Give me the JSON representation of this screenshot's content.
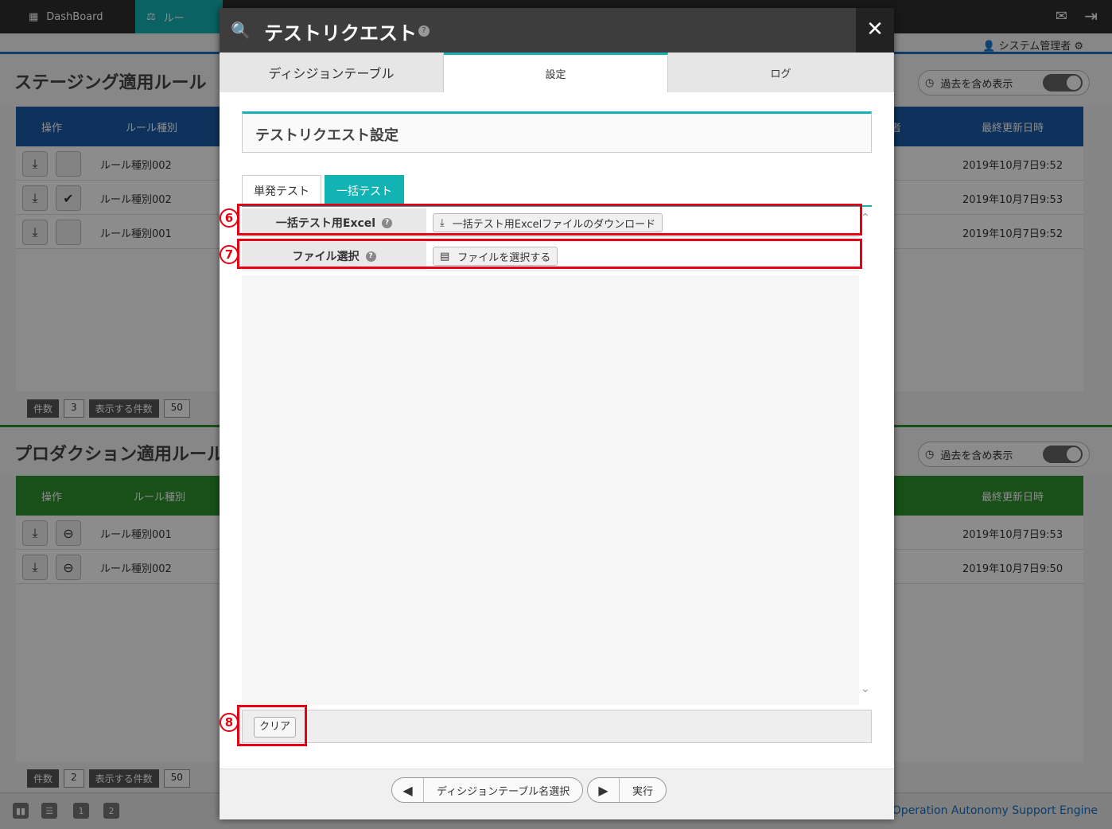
{
  "nav": {
    "dashboard": "DashBoard",
    "rules": "ルー"
  },
  "user": {
    "name": "システム管理者"
  },
  "staging": {
    "title": "ステージング適用ルール",
    "toggle_label": "過去を含め表示",
    "toggle_state": "OFF",
    "headers": {
      "ops": "操作",
      "type": "ルール種別",
      "author": "者",
      "updated": "最終更新日時"
    },
    "rows": [
      {
        "type": "ルール種別002",
        "updated": "2019年10月7日9:52"
      },
      {
        "type": "ルール種別002",
        "updated": "2019年10月7日9:53"
      },
      {
        "type": "ルール種別001",
        "updated": "2019年10月7日9:52"
      }
    ],
    "count_label": "件数",
    "count": "3",
    "per_page_label": "表示する件数",
    "per_page": "50"
  },
  "production": {
    "title": "プロダクション適用ルール",
    "toggle_label": "過去を含め表示",
    "toggle_state": "OFF",
    "headers": {
      "ops": "操作",
      "type": "ルール種別",
      "updated": "最終更新日時"
    },
    "rows": [
      {
        "type": "ルール種別001",
        "updated": "2019年10月7日9:53"
      },
      {
        "type": "ルール種別002",
        "updated": "2019年10月7日9:50"
      }
    ],
    "count_label": "件数",
    "count": "2",
    "per_page_label": "表示する件数",
    "per_page": "50"
  },
  "footer": {
    "text": "o Operation Autonomy Support Engine",
    "page1": "1",
    "page2": "2"
  },
  "modal": {
    "title": "テストリクエスト",
    "tabs": [
      "ディシジョンテーブル",
      "設定",
      "ログ"
    ],
    "section_title": "テストリクエスト設定",
    "subtabs": [
      "単発テスト",
      "一括テスト"
    ],
    "row_excel_label": "一括テスト用Excel",
    "row_excel_button": "一括テスト用Excelファイルのダウンロード",
    "row_file_label": "ファイル選択",
    "row_file_button": "ファイルを選択する",
    "clear": "クリア",
    "back_button": "ディシジョンテーブル名選択",
    "run_button": "実行",
    "badges": [
      "6",
      "7",
      "8"
    ]
  },
  "colors": {
    "accent": "#14b3b3",
    "highlight": "#e60012",
    "blue_head": "#1a5aa6",
    "green_head": "#2e8f2e"
  }
}
